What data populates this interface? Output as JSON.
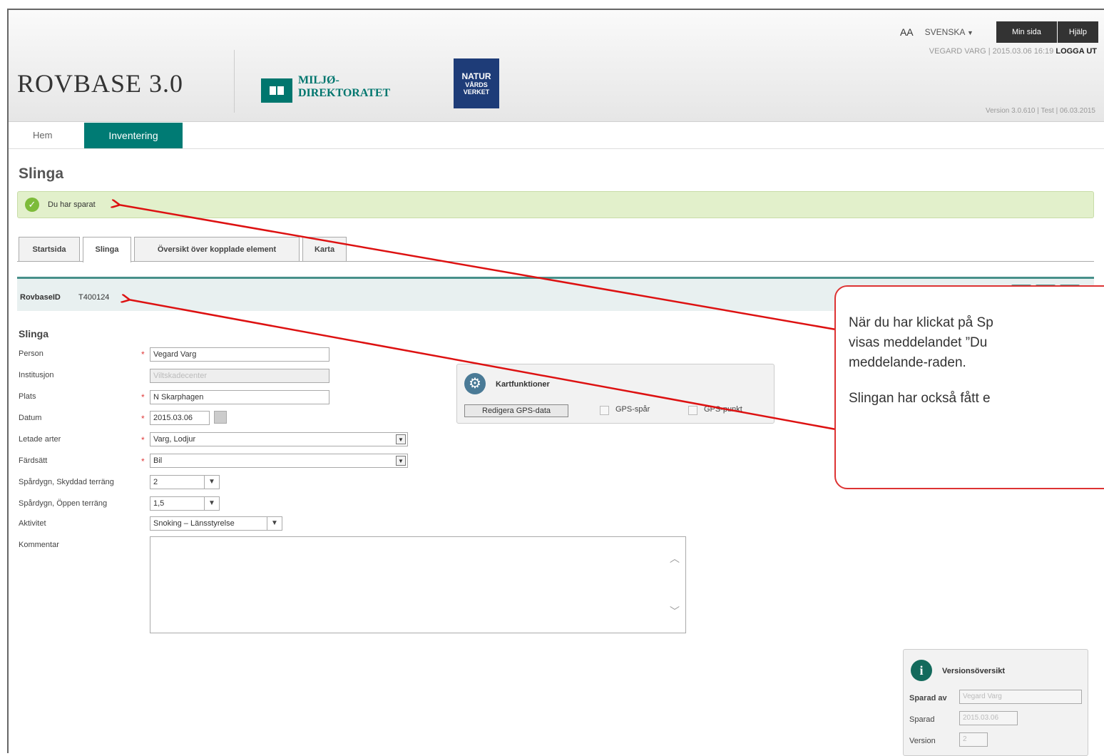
{
  "header": {
    "font_size_toggle": "AA",
    "language": "SVENSKA",
    "language_arrow": "▼",
    "min_sida": "Min sida",
    "hjalp": "Hjälp",
    "user_info": "VEGARD VARG | 2015.03.06 16:19",
    "logout": "LOGGA UT",
    "app_title": "ROVBASE 3.0",
    "miljo_line1": "MILJØ-",
    "miljo_line2": "DIREKTORATET",
    "natur_line1": "NATUR",
    "natur_line2": "VÅRDS",
    "natur_line3": "VERKET",
    "version_line": "Version 3.0.610 | Test | 06.03.2015"
  },
  "nav": {
    "hem": "Hem",
    "inventering": "Inventering"
  },
  "page_title": "Slinga",
  "message": "Du har sparat",
  "tabs": [
    "Startsida",
    "Slinga",
    "Översikt över kopplade element",
    "Karta"
  ],
  "rovbase": {
    "label": "RovbaseID",
    "value": "T400124"
  },
  "form": {
    "section_title": "Slinga",
    "person_label": "Person",
    "person_value": "Vegard Varg",
    "institusjon_label": "Institusjon",
    "institusjon_value": "Viltskadecenter",
    "plats_label": "Plats",
    "plats_value": "N Skarphagen",
    "datum_label": "Datum",
    "datum_value": "2015.03.06",
    "arter_label": "Letade arter",
    "arter_value": "Varg, Lodjur",
    "fardsatt_label": "Färdsätt",
    "fardsatt_value": "Bil",
    "skyddad_label": "Spårdygn, Skyddad terräng",
    "skyddad_value": "2",
    "oppen_label": "Spårdygn, Öppen terräng",
    "oppen_value": "1,5",
    "aktivitet_label": "Aktivitet",
    "aktivitet_value": "Snoking – Länsstyrelse",
    "kommentar_label": "Kommentar",
    "required_mark": "*"
  },
  "kartfunktioner": {
    "title": "Kartfunktioner",
    "edit_button": "Redigera GPS-data",
    "gps_spar": "GPS-spår",
    "gps_punkt": "GPS-punkt"
  },
  "callout": {
    "line1": "När du har klickat på Sp",
    "line2": "visas meddelandet ”Du",
    "line3": "meddelande-raden.",
    "line4": "Slingan har också fått e"
  },
  "versions": {
    "title": "Versionsöversikt",
    "sparad_av_label": "Sparad av",
    "sparad_av_value": "Vegard Varg",
    "sparad_label": "Sparad",
    "sparad_value": "2015.03.06",
    "version_label": "Version",
    "version_value": "2"
  },
  "colors": {
    "accent": "#007b74",
    "success_bg": "#e2f0cb",
    "annotation": "#dd1111"
  }
}
